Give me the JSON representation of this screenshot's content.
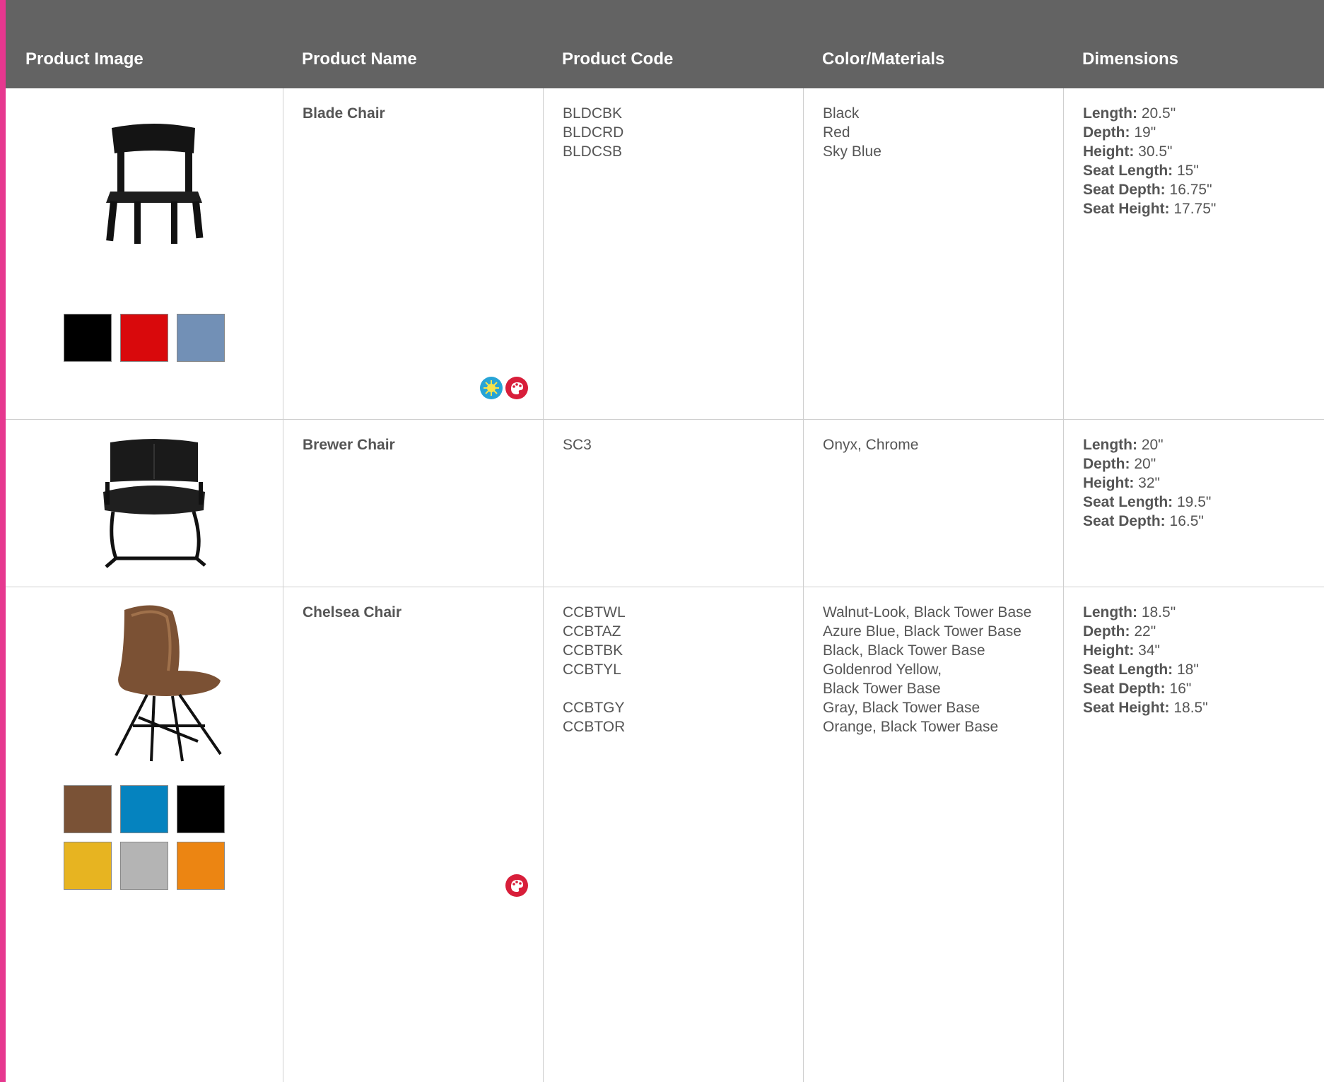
{
  "header": {
    "col_image": "Product Image",
    "col_name": "Product Name",
    "col_code": "Product Code",
    "col_color": "Color/Materials",
    "col_dimensions": "Dimensions"
  },
  "products": [
    {
      "name": "Blade Chair",
      "codes": [
        "BLDCBK",
        "BLDCRD",
        "BLDCSB"
      ],
      "colors": [
        "Black",
        "Red",
        "Sky Blue"
      ],
      "swatch_colors": [
        "#000000",
        "#d9090c",
        "#7290b6"
      ],
      "badges": [
        "sun-icon",
        "paint-palette-icon"
      ],
      "dimensions": [
        {
          "label": "Length:",
          "value": " 20.5\""
        },
        {
          "label": "Depth:",
          "value": " 19\""
        },
        {
          "label": "Height:",
          "value": " 30.5\""
        },
        {
          "label": "Seat Length:",
          "value": " 15\""
        },
        {
          "label": "Seat Depth:",
          "value": " 16.75\""
        },
        {
          "label": "Seat Height:",
          "value": " 17.75\""
        }
      ]
    },
    {
      "name": "Brewer Chair",
      "codes": [
        "SC3"
      ],
      "colors": [
        "Onyx, Chrome"
      ],
      "swatch_colors": [],
      "badges": [],
      "dimensions": [
        {
          "label": "Length:",
          "value": " 20\""
        },
        {
          "label": "Depth:",
          "value": " 20\""
        },
        {
          "label": "Height:",
          "value": " 32\""
        },
        {
          "label": "Seat Length:",
          "value": " 19.5\""
        },
        {
          "label": "Seat Depth:",
          "value": " 16.5\""
        }
      ]
    },
    {
      "name": "Chelsea Chair",
      "codes": [
        "CCBTWL",
        "CCBTAZ",
        "CCBTBK",
        "CCBTYL",
        "",
        "CCBTGY",
        "CCBTOR"
      ],
      "colors": [
        "Walnut-Look, Black Tower Base",
        "Azure Blue, Black Tower Base",
        "Black, Black Tower Base",
        "Goldenrod Yellow,",
        "Black Tower Base",
        "Gray, Black Tower Base",
        "Orange, Black Tower Base"
      ],
      "swatch_colors": [
        "#7a5236",
        "#0583bf",
        "#000000",
        "#e7b421",
        "#b4b4b4",
        "#ec8512"
      ],
      "badges": [
        "paint-palette-icon"
      ],
      "dimensions": [
        {
          "label": "Length:",
          "value": " 18.5\""
        },
        {
          "label": "Depth:",
          "value": " 22\""
        },
        {
          "label": "Height:",
          "value": " 34\""
        },
        {
          "label": "Seat Length:",
          "value": " 18\""
        },
        {
          "label": "Seat Depth:",
          "value": " 16\""
        },
        {
          "label": "Seat Height:",
          "value": " 18.5\""
        }
      ]
    }
  ]
}
